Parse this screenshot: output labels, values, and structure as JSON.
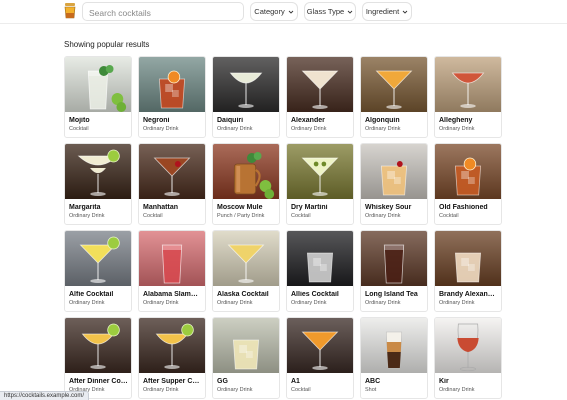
{
  "search": {
    "placeholder": "Search cocktails"
  },
  "filters": [
    {
      "label": "Category"
    },
    {
      "label": "Glass Type"
    },
    {
      "label": "Ingredient"
    }
  ],
  "heading": "Showing popular results",
  "cocktails": [
    {
      "name": "Mojito",
      "category": "Cocktail",
      "bg": "#dfe4dc",
      "glass": "highball",
      "drink": "#ecf0e6",
      "garnish": "mint"
    },
    {
      "name": "Negroni",
      "category": "Ordinary Drink",
      "bg": "#6f8a86",
      "glass": "rocks",
      "drink": "#c4471f",
      "garnish": "orange"
    },
    {
      "name": "Daiquiri",
      "category": "Ordinary Drink",
      "bg": "#2d2c2c",
      "glass": "coupe",
      "drink": "#e8ebd8",
      "garnish": "none"
    },
    {
      "name": "Alexander",
      "category": "Ordinary Drink",
      "bg": "#4a2e22",
      "glass": "martini",
      "drink": "#efe2cf",
      "garnish": "none"
    },
    {
      "name": "Algonquin",
      "category": "Ordinary Drink",
      "bg": "#7a5a34",
      "glass": "martini",
      "drink": "#f0a83a",
      "garnish": "none"
    },
    {
      "name": "Allegheny",
      "category": "Ordinary Drink",
      "bg": "#bfa27e",
      "glass": "coupe",
      "drink": "#d0563a",
      "garnish": "none"
    },
    {
      "name": "Margarita",
      "category": "Ordinary Drink",
      "bg": "#3a2518",
      "glass": "margarita",
      "drink": "#f1ecd2",
      "garnish": "lime"
    },
    {
      "name": "Manhattan",
      "category": "Cocktail",
      "bg": "#4a2c1d",
      "glass": "martini",
      "drink": "#9a4622",
      "garnish": "cherry"
    },
    {
      "name": "Moscow Mule",
      "category": "Punch / Party Drink",
      "bg": "#8e3a22",
      "glass": "mug",
      "drink": "#b77b52",
      "garnish": "mint"
    },
    {
      "name": "Dry Martini",
      "category": "Cocktail",
      "bg": "#7c7b33",
      "glass": "martini",
      "drink": "#eef3c6",
      "garnish": "olive"
    },
    {
      "name": "Whiskey Sour",
      "category": "Ordinary Drink",
      "bg": "#c9c5bf",
      "glass": "rocks",
      "drink": "#f1c27c",
      "garnish": "cherry"
    },
    {
      "name": "Old Fashioned",
      "category": "Cocktail",
      "bg": "#7b4a2a",
      "glass": "rocks",
      "drink": "#c75b24",
      "garnish": "orange"
    },
    {
      "name": "Alfie Cocktail",
      "category": "Ordinary Drink",
      "bg": "#7a8088",
      "glass": "martini",
      "drink": "#f2df5a",
      "garnish": "lime"
    },
    {
      "name": "Alabama Slammer",
      "category": "Ordinary Drink",
      "bg": "#d86e72",
      "glass": "highball",
      "drink": "#d9494f",
      "garnish": "none"
    },
    {
      "name": "Alaska Cocktail",
      "category": "Ordinary Drink",
      "bg": "#d6d0b9",
      "glass": "martini",
      "drink": "#efd36a",
      "garnish": "none"
    },
    {
      "name": "Allies Cocktail",
      "category": "Ordinary Drink",
      "bg": "#1f1f22",
      "glass": "rocks",
      "drink": "#cfcfcf",
      "garnish": "none"
    },
    {
      "name": "Long Island Tea",
      "category": "Ordinary Drink",
      "bg": "#5e3a28",
      "glass": "highball",
      "drink": "#4a1f14",
      "garnish": "none"
    },
    {
      "name": "Brandy Alexander",
      "category": "Ordinary Drink",
      "bg": "#6b4124",
      "glass": "rocks",
      "drink": "#f1dcc2",
      "garnish": "none"
    },
    {
      "name": "After Dinner Cocktail",
      "category": "Ordinary Drink",
      "bg": "#3d2a22",
      "glass": "coupe",
      "drink": "#f2c24a",
      "garnish": "lime"
    },
    {
      "name": "After Supper Cocktail",
      "category": "Ordinary Drink",
      "bg": "#3d2a22",
      "glass": "coupe",
      "drink": "#f2c24a",
      "garnish": "lime"
    },
    {
      "name": "GG",
      "category": "Ordinary Drink",
      "bg": "#bcbfae",
      "glass": "rocks",
      "drink": "#efe7b8",
      "garnish": "none"
    },
    {
      "name": "A1",
      "category": "Cocktail",
      "bg": "#3a2a25",
      "glass": "martini",
      "drink": "#f09a2c",
      "garnish": "none"
    },
    {
      "name": "ABC",
      "category": "Shot",
      "bg": "#e8e8e6",
      "glass": "shot",
      "drink": "#4b2a17",
      "garnish": "none"
    },
    {
      "name": "Kir",
      "category": "Ordinary Drink",
      "bg": "#f2f0ee",
      "glass": "wine",
      "drink": "#c94b32",
      "garnish": "none"
    }
  ],
  "status_url": "https://cocktails.example.com/"
}
